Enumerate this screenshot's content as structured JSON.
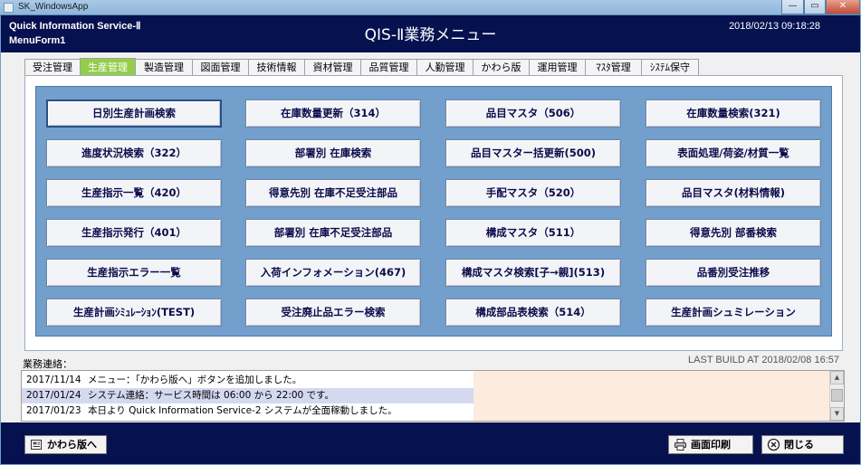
{
  "window": {
    "title": "SK_WindowsApp"
  },
  "header": {
    "app_name": "Quick Information Service-Ⅱ",
    "form_name": "MenuForm1",
    "title": "QIS-Ⅱ業務メニュー",
    "datetime": "2018/02/13 09:18:28"
  },
  "tabs": [
    {
      "label": "受注管理",
      "active": false
    },
    {
      "label": "生産管理",
      "active": true
    },
    {
      "label": "製造管理",
      "active": false
    },
    {
      "label": "図面管理",
      "active": false
    },
    {
      "label": "技術情報",
      "active": false
    },
    {
      "label": "資材管理",
      "active": false
    },
    {
      "label": "品質管理",
      "active": false
    },
    {
      "label": "人勤管理",
      "active": false
    },
    {
      "label": "かわら版",
      "active": false
    },
    {
      "label": "運用管理",
      "active": false
    },
    {
      "label": "ﾏｽﾀ管理",
      "active": false
    },
    {
      "label": "ｼｽﾃﾑ保守",
      "active": false
    }
  ],
  "menu_buttons": [
    "日別生産計画検索",
    "在庫数量更新（314）",
    "品目マスタ（506）",
    "在庫数量検索(321)",
    "進度状況検索（322）",
    "部署別 在庫検索",
    "品目マスター括更新(500)",
    "表面処理/荷姿/材質一覧",
    "生産指示一覧（420）",
    "得意先別 在庫不足受注部品",
    "手配マスタ（520）",
    "品目マスタ(材料情報)",
    "生産指示発行（401）",
    "部署別 在庫不足受注部品",
    "構成マスタ（511）",
    "得意先別 部番検索",
    "生産指示エラー一覧",
    "入荷インフォメーション(467)",
    "構成マスタ検索[子→親](513)",
    "品番別受注推移",
    "生産計画ｼﾐｭﾚｰｼｮﾝ(TEST)",
    "受注廃止品エラー検索",
    "構成部品表検索（514）",
    "生産計画シュミレーション"
  ],
  "notices": {
    "label": "業務連絡：",
    "build_info": "LAST BUILD AT 2018/02/08 16:57",
    "items": [
      {
        "date": "2017/11/14",
        "text": "メニュー：「かわら版へ」ボタンを追加しました。"
      },
      {
        "date": "2017/01/24",
        "text": "システム連絡：サービス時間は 06:00 から 22:00 です。"
      },
      {
        "date": "2017/01/23",
        "text": "本日より Quick Information Service-2 システムが全面稼動しました。"
      }
    ]
  },
  "footer": {
    "kawara_button": "かわら版へ",
    "print_button": "画面印刷",
    "close_button": "閉じる"
  },
  "icons": {
    "kawara": "newspaper-icon",
    "print": "printer-icon",
    "close": "close-icon"
  },
  "colors": {
    "header_bg": "#06114f",
    "active_tab": "#94cd4b",
    "button_area": "#729fcc"
  }
}
